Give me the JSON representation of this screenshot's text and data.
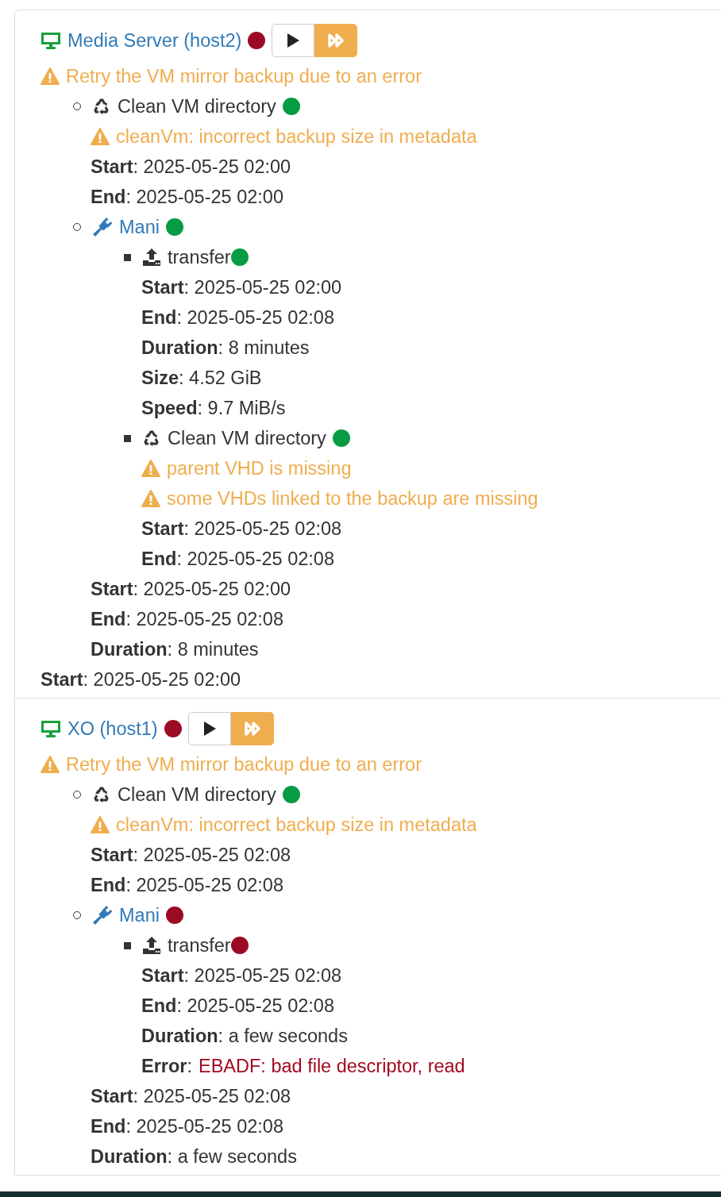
{
  "vms": [
    {
      "name": "Media Server (host2)",
      "color": "#9b0a24",
      "warnings": [
        "Retry the VM mirror backup due to an error"
      ],
      "tasks": [
        {
          "kind": "clean",
          "title": "Clean VM directory",
          "color": "#079b43",
          "warnings": [
            "cleanVm: incorrect backup size in metadata"
          ],
          "fields": [
            {
              "text": "**Start**: 2025-05-25 02:00"
            },
            {
              "text": "**End**: 2025-05-25 02:00"
            }
          ]
        },
        {
          "kind": "remote",
          "title": "Mani",
          "color": "#079b43",
          "children": [
            {
              "kind": "transfer",
              "title": "transfer",
              "color": "#079b43",
              "fields": [
                {
                  "text": "**Start**: 2025-05-25 02:00"
                },
                {
                  "text": "**End**: 2025-05-25 02:08"
                },
                {
                  "text": "**Duration**: 8 minutes"
                },
                {
                  "text": "**Size**: 4.52 GiB"
                },
                {
                  "text": "**Speed**: 9.7 MiB/s"
                }
              ]
            },
            {
              "kind": "clean",
              "title": "Clean VM directory",
              "color": "#079b43",
              "warnings": [
                "parent VHD is missing",
                "some VHDs linked to the backup are missing"
              ],
              "fields": [
                {
                  "text": "**Start**: 2025-05-25 02:08"
                },
                {
                  "text": "**End**: 2025-05-25 02:08"
                }
              ]
            }
          ],
          "fields": [
            {
              "text": "**Start**: 2025-05-25 02:00"
            },
            {
              "text": "**End**: 2025-05-25 02:08"
            },
            {
              "text": "**Duration**: 8 minutes"
            }
          ]
        }
      ],
      "fields": [
        {
          "text": "**Start**: 2025-05-25 02:00"
        }
      ]
    },
    {
      "name": "XO (host1)",
      "color": "#9b0a24",
      "warnings": [
        "Retry the VM mirror backup due to an error"
      ],
      "tasks": [
        {
          "kind": "clean",
          "title": "Clean VM directory",
          "color": "#079b43",
          "warnings": [
            "cleanVm: incorrect backup size in metadata"
          ],
          "fields": [
            {
              "text": "**Start**: 2025-05-25 02:08"
            },
            {
              "text": "**End**: 2025-05-25 02:08"
            }
          ]
        },
        {
          "kind": "remote",
          "title": "Mani",
          "color": "#9b0a24",
          "children": [
            {
              "kind": "transfer",
              "title": "transfer",
              "color": "#9b0a24",
              "fields": [
                {
                  "text": "**Start**: 2025-05-25 02:08"
                },
                {
                  "text": "**End**: 2025-05-25 02:08"
                },
                {
                  "text": "**Duration**: a few seconds"
                },
                {
                  "kind": "error",
                  "label": "**Error**:",
                  "message": "EBADF: bad file descriptor, read"
                }
              ]
            }
          ],
          "fields": [
            {
              "text": "**Start**: 2025-05-25 02:08"
            },
            {
              "text": "**End**: 2025-05-25 02:08"
            },
            {
              "text": "**Duration**: a few seconds"
            }
          ]
        }
      ]
    }
  ]
}
